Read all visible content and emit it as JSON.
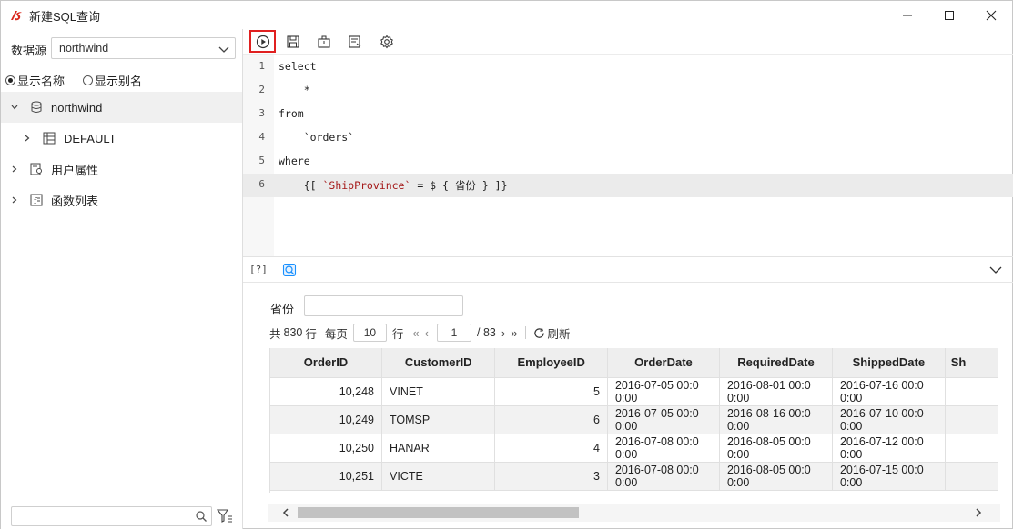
{
  "window": {
    "title": "新建SQL查询",
    "icons": {
      "logo": "app-logo-icon",
      "minimize": "minimize-icon",
      "maximize": "maximize-icon",
      "close": "close-icon"
    }
  },
  "sidebar": {
    "datasource_label": "数据源",
    "datasource_value": "northwind",
    "radio_show_name": "显示名称",
    "radio_show_alias": "显示别名",
    "radio_selected": "显示名称",
    "tree": [
      {
        "label": "northwind",
        "icon": "database-icon",
        "expanded": true,
        "level": 0
      },
      {
        "label": "DEFAULT",
        "icon": "table-schema-icon",
        "expanded": false,
        "level": 1
      },
      {
        "label": "用户属性",
        "icon": "user-attribute-icon",
        "expanded": false,
        "level": 0
      },
      {
        "label": "函数列表",
        "icon": "function-list-icon",
        "expanded": false,
        "level": 0
      }
    ],
    "search_placeholder": ""
  },
  "toolbar": {
    "buttons": [
      "run-icon",
      "save-icon",
      "toolbox-icon",
      "format-sql-icon",
      "settings-icon"
    ]
  },
  "editor": {
    "lines": [
      {
        "n": "1",
        "text": "select"
      },
      {
        "n": "2",
        "text": "    *"
      },
      {
        "n": "3",
        "text": "from"
      },
      {
        "n": "4",
        "text": "    `orders`"
      },
      {
        "n": "5",
        "text": "where"
      },
      {
        "n": "6",
        "text": "    {[ `ShipProvince` = $ { 省份 } ]}"
      }
    ],
    "active_line": "6"
  },
  "results": {
    "help_label": "[?]",
    "param_label": "省份",
    "param_value": "",
    "pager": {
      "total_prefix": "共",
      "total": "830",
      "total_suffix": "行",
      "per_page_prefix": "每页",
      "per_page": "10",
      "per_page_suffix": "行",
      "page": "1",
      "pages": "/ 83",
      "refresh_label": "刷新"
    },
    "columns": [
      "OrderID",
      "CustomerID",
      "EmployeeID",
      "OrderDate",
      "RequiredDate",
      "ShippedDate",
      "Sh"
    ],
    "rows": [
      [
        "10,248",
        "VINET",
        "5",
        "2016-07-05 00:0 0:00",
        "2016-08-01 00:0 0:00",
        "2016-07-16 00:0 0:00"
      ],
      [
        "10,249",
        "TOMSP",
        "6",
        "2016-07-05 00:0 0:00",
        "2016-08-16 00:0 0:00",
        "2016-07-10 00:0 0:00"
      ],
      [
        "10,250",
        "HANAR",
        "4",
        "2016-07-08 00:0 0:00",
        "2016-08-05 00:0 0:00",
        "2016-07-12 00:0 0:00"
      ],
      [
        "10,251",
        "VICTE",
        "3",
        "2016-07-08 00:0 0:00",
        "2016-08-05 00:0 0:00",
        "2016-07-15 00:0 0:00"
      ]
    ]
  },
  "colors": {
    "run_highlight": "#e02020",
    "keyword": "#1a1aa6",
    "string": "#a31515",
    "accent": "#1890ff"
  }
}
